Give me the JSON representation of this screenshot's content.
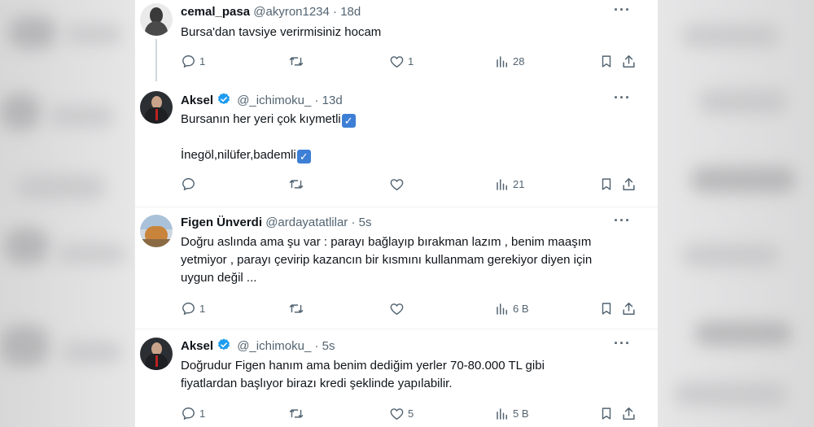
{
  "tweets": [
    {
      "name": "cemal_pasa",
      "handle": "@akyron1234",
      "dot": "·",
      "time": "18d",
      "text_lines": [
        "Bursa'dan tavsiye verirmisiniz hocam"
      ],
      "replies": "1",
      "retweets": "",
      "likes": "1",
      "views": "28",
      "verified": false,
      "avatar": "avatar-cemal"
    },
    {
      "name": "Aksel",
      "handle": "@_ichimoku_",
      "dot": "·",
      "time": "13d",
      "text_lines": [
        "Bursanın her yeri çok kıymetli",
        "İnegöl,nilüfer,bademli"
      ],
      "replies": "",
      "retweets": "",
      "likes": "",
      "views": "21",
      "verified": true,
      "avatar": "avatar-aksel"
    },
    {
      "name": "Figen Ünverdi",
      "handle": "@ardayatatlilar",
      "dot": "·",
      "time": "5s",
      "text_lines": [
        "Doğru aslında ama şu var : parayı bağlayıp bırakman lazım , benim maaşım",
        "yetmiyor , parayı çevirip kazancın bir kısmını kullanmam gerekiyor diyen için",
        "uygun değil ..."
      ],
      "replies": "1",
      "retweets": "",
      "likes": "",
      "views": "6 B",
      "verified": false,
      "avatar": "avatar-figen"
    },
    {
      "name": "Aksel",
      "handle": "@_ichimoku_",
      "dot": "·",
      "time": "5s",
      "text_lines": [
        "Doğrudur Figen hanım ama benim dediğim yerler 70-80.000 TL gibi",
        "fiyatlardan başlıyor birazı kredi şeklinde yapılabilir."
      ],
      "replies": "1",
      "retweets": "",
      "likes": "5",
      "views": "5 B",
      "verified": true,
      "avatar": "avatar-aksel"
    }
  ],
  "icons": {
    "reply": "reply-icon",
    "retweet": "retweet-icon",
    "like": "like-icon",
    "views": "views-icon",
    "bookmark": "bookmark-icon",
    "share": "share-icon",
    "more": "more-icon",
    "verified": "verified-badge-icon",
    "check": "check-mark-emoji-icon"
  },
  "colors": {
    "text": "#0f1419",
    "secondary": "#536471",
    "verified": "#1d9bf0",
    "emoji_check": "#3e7fd6"
  },
  "more_label": "···",
  "check_symbol": "✓"
}
